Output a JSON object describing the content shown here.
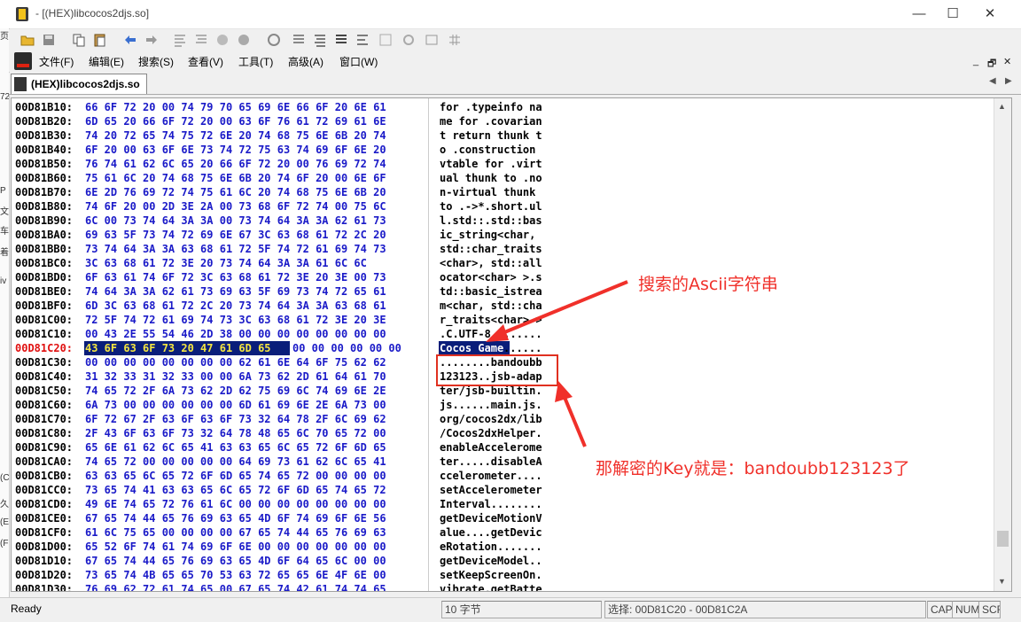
{
  "window": {
    "title": "- [(HEX)libcocos2djs.so]",
    "minimize": "—",
    "maximize": "☐",
    "close": "✕"
  },
  "left_strip_chars": [
    "页",
    "72",
    "P",
    "文",
    "车",
    "着",
    "iv",
    "(C",
    "久",
    "(E",
    "(F"
  ],
  "menu": [
    {
      "label": "文件(F)"
    },
    {
      "label": "编辑(E)"
    },
    {
      "label": "搜索(S)"
    },
    {
      "label": "查看(V)"
    },
    {
      "label": "工具(T)"
    },
    {
      "label": "高级(A)"
    },
    {
      "label": "窗口(W)"
    }
  ],
  "mdi_controls": [
    "_",
    "🗗",
    "✕"
  ],
  "tab": {
    "label": "(HEX)libcocos2djs.so",
    "prev": "◀",
    "next": "▶"
  },
  "hex_rows": [
    {
      "addr": "00D81B10:",
      "hex": "66 6F 72 20 00 74 79 70 65 69 6E 66 6F 20 6E 61",
      "ascii": "for .typeinfo na"
    },
    {
      "addr": "00D81B20:",
      "hex": "6D 65 20 66 6F 72 20 00 63 6F 76 61 72 69 61 6E",
      "ascii": "me for .covarian"
    },
    {
      "addr": "00D81B30:",
      "hex": "74 20 72 65 74 75 72 6E 20 74 68 75 6E 6B 20 74",
      "ascii": "t return thunk t"
    },
    {
      "addr": "00D81B40:",
      "hex": "6F 20 00 63 6F 6E 73 74 72 75 63 74 69 6F 6E 20",
      "ascii": "o .construction "
    },
    {
      "addr": "00D81B50:",
      "hex": "76 74 61 62 6C 65 20 66 6F 72 20 00 76 69 72 74",
      "ascii": "vtable for .virt"
    },
    {
      "addr": "00D81B60:",
      "hex": "75 61 6C 20 74 68 75 6E 6B 20 74 6F 20 00 6E 6F",
      "ascii": "ual thunk to .no"
    },
    {
      "addr": "00D81B70:",
      "hex": "6E 2D 76 69 72 74 75 61 6C 20 74 68 75 6E 6B 20",
      "ascii": "n-virtual thunk "
    },
    {
      "addr": "00D81B80:",
      "hex": "74 6F 20 00 2D 3E 2A 00 73 68 6F 72 74 00 75 6C",
      "ascii": "to .->*.short.ul"
    },
    {
      "addr": "00D81B90:",
      "hex": "6C 00 73 74 64 3A 3A 00 73 74 64 3A 3A 62 61 73",
      "ascii": "l.std::.std::bas"
    },
    {
      "addr": "00D81BA0:",
      "hex": "69 63 5F 73 74 72 69 6E 67 3C 63 68 61 72 2C 20",
      "ascii": "ic_string<char, "
    },
    {
      "addr": "00D81BB0:",
      "hex": "73 74 64 3A 3A 63 68 61 72 5F 74 72 61 69 74 73",
      "ascii": "std::char_traits"
    },
    {
      "addr": "00D81BC0:",
      "hex": "3C 63 68 61 72 3E 20 73 74 64 3A 3A 61 6C 6C",
      "ascii": "<char>, std::all"
    },
    {
      "addr": "00D81BD0:",
      "hex": "6F 63 61 74 6F 72 3C 63 68 61 72 3E 20 3E 00 73",
      "ascii": "ocator<char> >.s"
    },
    {
      "addr": "00D81BE0:",
      "hex": "74 64 3A 3A 62 61 73 69 63 5F 69 73 74 72 65 61",
      "ascii": "td::basic_istrea"
    },
    {
      "addr": "00D81BF0:",
      "hex": "6D 3C 63 68 61 72 2C 20 73 74 64 3A 3A 63 68 61",
      "ascii": "m<char, std::cha"
    },
    {
      "addr": "00D81C00:",
      "hex": "72 5F 74 72 61 69 74 73 3C 63 68 61 72 3E 20 3E",
      "ascii": "r_traits<char> >"
    },
    {
      "addr": "00D81C10:",
      "hex": "00 43 2E 55 54 46 2D 38 00 00 00 00 00 00 00 00",
      "ascii": ".C.UTF-8........"
    },
    {
      "addr": "00D81C20:",
      "hex": "43 6F 63 6F 73 20 47 61 6D 65",
      "hex_rest": "00 00 00 00 00 00",
      "ascii": "Cocos Game",
      "ascii_rest": "......",
      "current": true
    },
    {
      "addr": "00D81C30:",
      "hex": "00 00 00 00 00 00 00 00 62 61 6E 64 6F 75 62 62",
      "ascii": "........bandoubb"
    },
    {
      "addr": "00D81C40:",
      "hex": "31 32 33 31 32 33 00 00 6A 73 62 2D 61 64 61 70",
      "ascii": "123123..jsb-adap"
    },
    {
      "addr": "00D81C50:",
      "hex": "74 65 72 2F 6A 73 62 2D 62 75 69 6C 74 69 6E 2E",
      "ascii": "ter/jsb-builtin."
    },
    {
      "addr": "00D81C60:",
      "hex": "6A 73 00 00 00 00 00 00 6D 61 69 6E 2E 6A 73 00",
      "ascii": "js......main.js."
    },
    {
      "addr": "00D81C70:",
      "hex": "6F 72 67 2F 63 6F 63 6F 73 32 64 78 2F 6C 69 62",
      "ascii": "org/cocos2dx/lib"
    },
    {
      "addr": "00D81C80:",
      "hex": "2F 43 6F 63 6F 73 32 64 78 48 65 6C 70 65 72 00",
      "ascii": "/Cocos2dxHelper."
    },
    {
      "addr": "00D81C90:",
      "hex": "65 6E 61 62 6C 65 41 63 63 65 6C 65 72 6F 6D 65",
      "ascii": "enableAccelerome"
    },
    {
      "addr": "00D81CA0:",
      "hex": "74 65 72 00 00 00 00 00 64 69 73 61 62 6C 65 41",
      "ascii": "ter.....disableA"
    },
    {
      "addr": "00D81CB0:",
      "hex": "63 63 65 6C 65 72 6F 6D 65 74 65 72 00 00 00 00",
      "ascii": "ccelerometer...."
    },
    {
      "addr": "00D81CC0:",
      "hex": "73 65 74 41 63 63 65 6C 65 72 6F 6D 65 74 65 72",
      "ascii": "setAccelerometer"
    },
    {
      "addr": "00D81CD0:",
      "hex": "49 6E 74 65 72 76 61 6C 00 00 00 00 00 00 00 00",
      "ascii": "Interval........"
    },
    {
      "addr": "00D81CE0:",
      "hex": "67 65 74 44 65 76 69 63 65 4D 6F 74 69 6F 6E 56",
      "ascii": "getDeviceMotionV"
    },
    {
      "addr": "00D81CF0:",
      "hex": "61 6C 75 65 00 00 00 00 67 65 74 44 65 76 69 63",
      "ascii": "alue....getDevic"
    },
    {
      "addr": "00D81D00:",
      "hex": "65 52 6F 74 61 74 69 6F 6E 00 00 00 00 00 00 00",
      "ascii": "eRotation......."
    },
    {
      "addr": "00D81D10:",
      "hex": "67 65 74 44 65 76 69 63 65 4D 6F 64 65 6C 00 00",
      "ascii": "getDeviceModel.."
    },
    {
      "addr": "00D81D20:",
      "hex": "73 65 74 4B 65 65 70 53 63 72 65 65 6E 4F 6E 00",
      "ascii": "setKeepScreenOn."
    },
    {
      "addr": "00D81D30:",
      "hex": "76 69 62 72 61 74 65 00 67 65 74 42 61 74 74 65",
      "ascii": "vibrate.getBatte"
    }
  ],
  "annotations": {
    "ascii_label": "搜索的Ascii字符串",
    "key_label": "那解密的Key就是：bandoubb123123了",
    "color": "#f0302a"
  },
  "status": {
    "ready": "Ready",
    "bytes": "10 字节",
    "selection": "选择: 00D81C20 - 00D81C2A",
    "cap": "CAP",
    "num": "NUM",
    "scrl": "SCRL"
  },
  "colors": {
    "hex_text": "#1a1ac8",
    "selection_bg": "#0a1e7a",
    "selection_hex": "#f5e640",
    "current_addr": "#e01010"
  }
}
